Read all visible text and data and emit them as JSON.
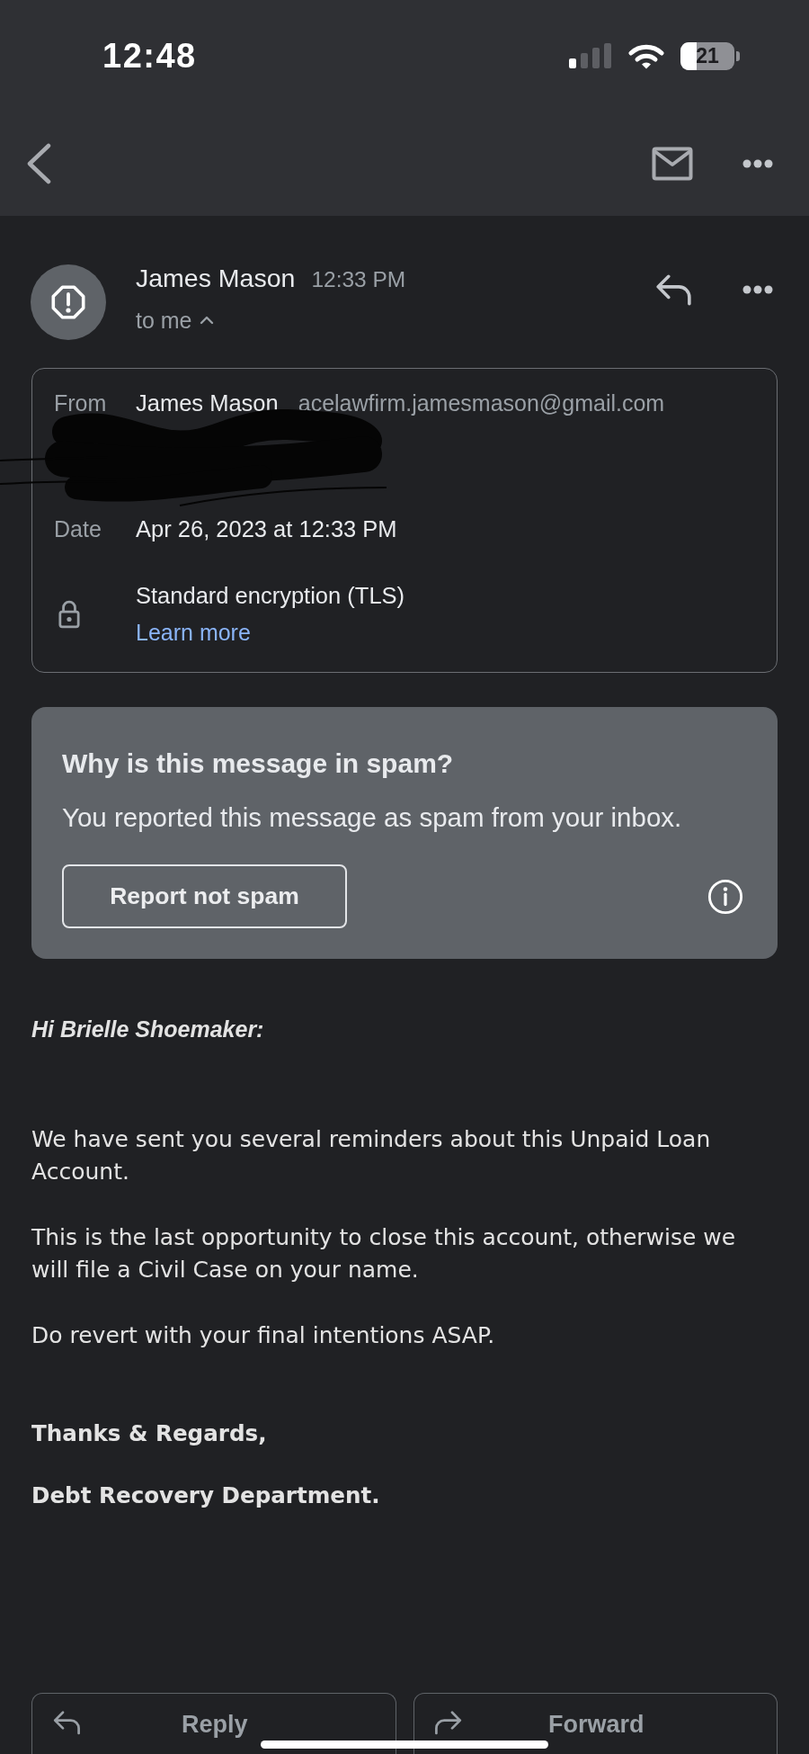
{
  "status_bar": {
    "time": "12:48",
    "battery": "21"
  },
  "message": {
    "sender": "James Mason",
    "time": "12:33 PM",
    "recipient": "to me",
    "expanded": true
  },
  "details": [
    {
      "kind": "sender",
      "label": "From",
      "name": "James Mason",
      "email": "acelawfirm.jamesmason@gmail.com"
    },
    {
      "kind": "redacted"
    },
    {
      "kind": "field",
      "label": "Date",
      "value": "Apr 26, 2023 at 12:33 PM"
    },
    {
      "kind": "security",
      "value": "Standard encryption (TLS)",
      "link": "Learn more"
    }
  ],
  "spam_notice": {
    "title": "Why is this message in spam?",
    "text": "You reported this message as spam from your inbox.",
    "button": "Report not spam"
  },
  "body": {
    "greeting": "Hi Brielle Shoemaker:",
    "paragraphs": [
      "We have sent you several reminders about this Unpaid Loan Account.",
      "This is the last opportunity to close this account, otherwise we will file a Civil Case on your name.",
      "Do revert with your final intentions ASAP."
    ],
    "signature": [
      "Thanks & Regards,",
      "Debt Recovery Department."
    ]
  },
  "actions": [
    {
      "kind": "reply",
      "label": "Reply"
    },
    {
      "kind": "forward",
      "label": "Forward"
    }
  ]
}
